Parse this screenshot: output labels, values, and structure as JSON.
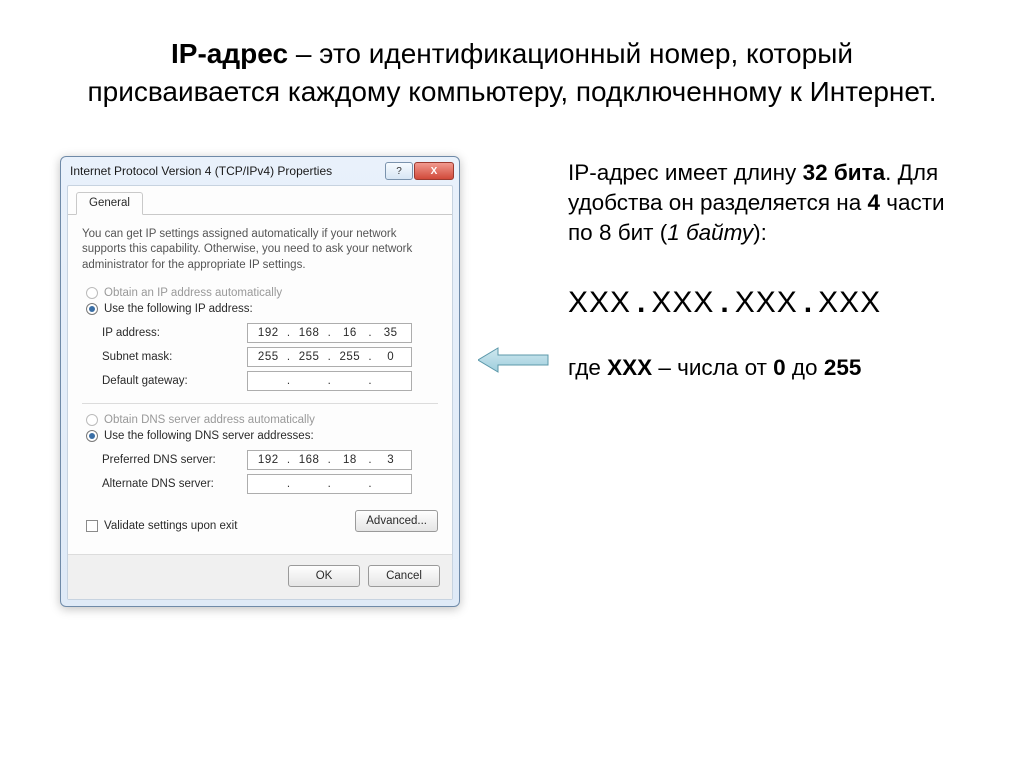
{
  "slide": {
    "title_bold": "IP-адрес",
    "title_rest": " – это идентификационный номер, который присваивается каждому компьютеру, подключенному к Интернет."
  },
  "dialog": {
    "title": "Internet Protocol Version 4 (TCP/IPv4) Properties",
    "help_icon": "?",
    "close_icon": "X",
    "tab_general": "General",
    "intro": "You can get IP settings assigned automatically if your network supports this capability. Otherwise, you need to ask your network administrator for the appropriate IP settings.",
    "opt_auto_ip": "Obtain an IP address automatically",
    "opt_manual_ip": "Use the following IP address:",
    "label_ip": "IP address:",
    "label_mask": "Subnet mask:",
    "label_gw": "Default gateway:",
    "ip": {
      "o1": "192",
      "o2": "168",
      "o3": "16",
      "o4": "35"
    },
    "mask": {
      "o1": "255",
      "o2": "255",
      "o3": "255",
      "o4": "0"
    },
    "opt_auto_dns": "Obtain DNS server address automatically",
    "opt_manual_dns": "Use the following DNS server addresses:",
    "label_pdns": "Preferred DNS server:",
    "label_adns": "Alternate DNS server:",
    "pdns": {
      "o1": "192",
      "o2": "168",
      "o3": "18",
      "o4": "3"
    },
    "validate": "Validate settings upon exit",
    "btn_advanced": "Advanced...",
    "btn_ok": "OK",
    "btn_cancel": "Cancel"
  },
  "right": {
    "p1_a": "IP-адрес имеет длину ",
    "p1_b": "32 бита",
    "p1_c": ". Для удобства он разделяется на ",
    "p1_d": "4",
    "p1_e": " части по 8 бит (",
    "p1_f": "1 байту",
    "p1_g": "):",
    "xxx": "ХХХ",
    "w_a": "где ",
    "w_b": "ХХХ",
    "w_c": " – числа от ",
    "w_d": "0",
    "w_e": " до ",
    "w_f": "255"
  }
}
